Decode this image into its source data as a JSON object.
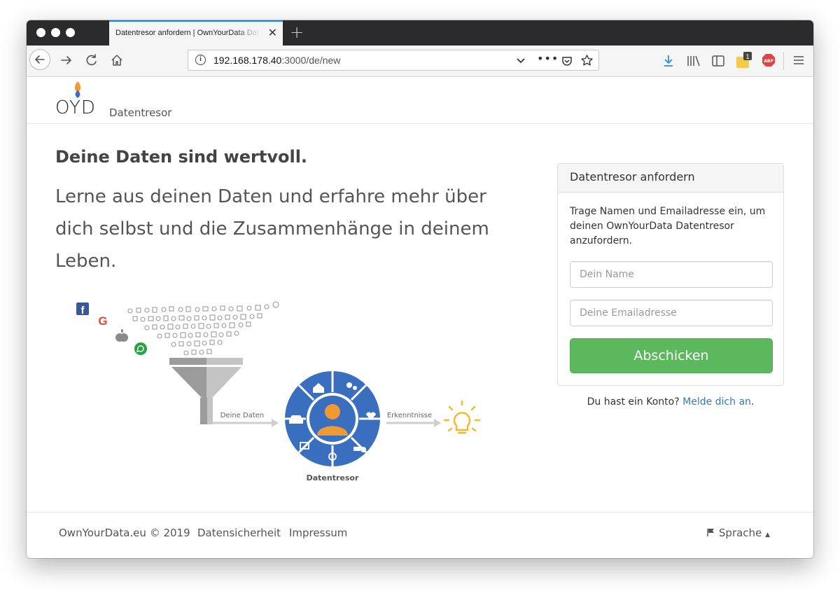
{
  "browser": {
    "tab_title": "Datentresor anfordern | OwnYourData Datentresor",
    "url_host": "192.168.178.40",
    "url_rest": ":3000/de/new"
  },
  "header": {
    "logo": "OYD",
    "brand": "Datentresor"
  },
  "hero": {
    "headline": "Deine Daten sind wertvoll.",
    "lead": "Lerne aus deinen Daten und erfahre mehr über dich selbst und die Zusammenhänge in deinem Leben."
  },
  "diagram": {
    "label_data": "Deine Daten",
    "label_insights": "Erkenntnisse",
    "label_vault": "Datentresor"
  },
  "panel": {
    "title": "Datentresor anfordern",
    "description": "Trage Namen und Emailadresse ein, um deinen OwnYourData Datentresor anzufordern.",
    "name_placeholder": "Dein Name",
    "email_placeholder": "Deine Emailadresse",
    "submit": "Abschicken"
  },
  "login": {
    "question": "Du hast ein Konto?",
    "link": "Melde dich an"
  },
  "footer": {
    "copyright": "OwnYourData.eu © 2019",
    "privacy": "Datensicherheit",
    "imprint": "Impressum",
    "language": "Sprache"
  },
  "colors": {
    "accent_green": "#5cb85c",
    "link_blue": "#337ab7",
    "vault_blue": "#3a6fbf",
    "person_orange": "#f09a36",
    "bulb_yellow": "#f5b82e"
  }
}
